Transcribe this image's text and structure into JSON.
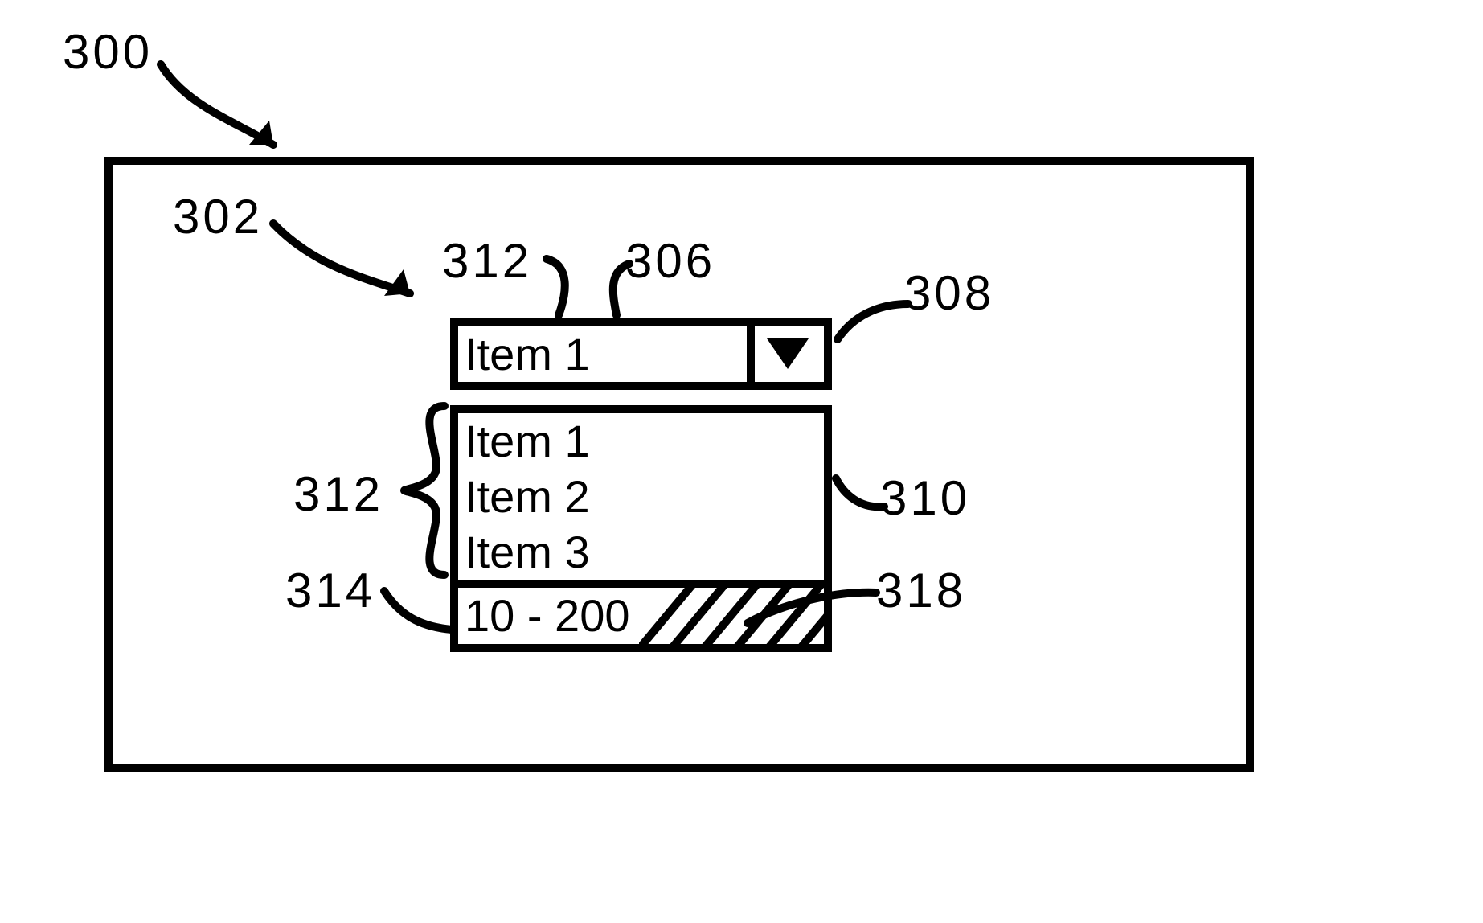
{
  "refs": {
    "window": "300",
    "control": "302",
    "textbox": "306",
    "selected_item_top": "312",
    "button": "308",
    "listbox": "310",
    "items_group": "312",
    "value_item": "314",
    "hatched_region": "318"
  },
  "combo": {
    "selected": "Item 1"
  },
  "list": {
    "options": [
      "Item 1",
      "Item 2",
      "Item 3"
    ],
    "valueItem": "10 - 200"
  }
}
